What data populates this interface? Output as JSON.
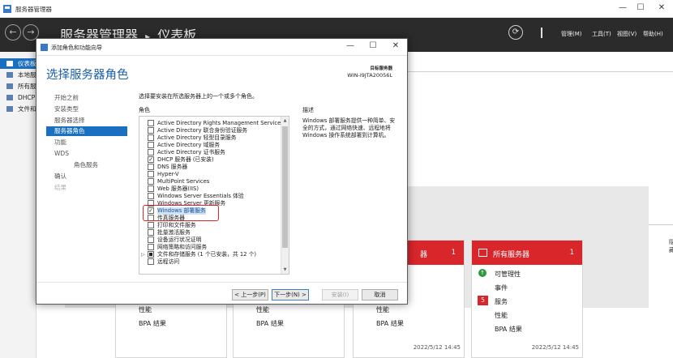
{
  "window": {
    "title": "服务器管理器",
    "controls": {
      "minimize": "—",
      "maximize": "☐",
      "close": "✕"
    }
  },
  "header": {
    "title": "服务器管理器",
    "separator": "▸",
    "page": "仪表板",
    "back": "←",
    "forward": "→",
    "refresh": "⟳",
    "menu": [
      "管理(M)",
      "工具(T)",
      "视图(V)",
      "帮助(H)"
    ]
  },
  "sidebar": {
    "items": [
      {
        "label": "仪表板",
        "active": true
      },
      {
        "label": "本地服务器"
      },
      {
        "label": "所有服务器"
      },
      {
        "label": "DHCP"
      },
      {
        "label": "文件和存储服务"
      }
    ]
  },
  "dashboard": {
    "hide": "隐藏",
    "tiles": [
      {
        "rows": [
          "性能",
          "BPA 结果"
        ]
      },
      {
        "rows": [
          "性能",
          "BPA 结果"
        ]
      },
      {
        "name": "器",
        "count": "1",
        "rows": [
          "性能",
          "BPA 结果"
        ],
        "date": "2022/5/12 14:45"
      },
      {
        "name": "所有服务器",
        "count": "1",
        "manageability": "可管理性",
        "events": "事件",
        "services": "服务",
        "services_badge": "5",
        "perf": "性能",
        "bpa": "BPA 结果",
        "date": "2022/5/12 14:45"
      }
    ]
  },
  "dialog": {
    "title": "添加角色和功能向导",
    "heading": "选择服务器角色",
    "target_label": "目标服务器",
    "target_value": "WIN-I9JTA20056L",
    "instruction": "选择要安装在所选服务器上的一个或多个角色。",
    "roles_header": "角色",
    "desc_header": "描述",
    "description": "Windows 部署服务提供一种简单、安全的方式，通过网络快速、远程地将 Windows 操作系统部署到计算机。",
    "steps": [
      {
        "label": "开始之前"
      },
      {
        "label": "安装类型"
      },
      {
        "label": "服务器选择"
      },
      {
        "label": "服务器角色",
        "active": true
      },
      {
        "label": "功能"
      },
      {
        "label": "WDS"
      },
      {
        "label": "角色服务",
        "sub": true
      },
      {
        "label": "确认"
      },
      {
        "label": "结果",
        "dim": true
      }
    ],
    "roles": [
      {
        "label": "Active Directory Rights Management Services",
        "checked": false
      },
      {
        "label": "Active Directory 联合身份验证服务",
        "checked": false
      },
      {
        "label": "Active Directory 轻型目录服务",
        "checked": false
      },
      {
        "label": "Active Directory 域服务",
        "checked": false
      },
      {
        "label": "Active Directory 证书服务",
        "checked": false
      },
      {
        "label": "DHCP 服务器 (已安装)",
        "checked": true
      },
      {
        "label": "DNS 服务器",
        "checked": false
      },
      {
        "label": "Hyper-V",
        "checked": false
      },
      {
        "label": "MultiPoint Services",
        "checked": false
      },
      {
        "label": "Web 服务器(IIS)",
        "checked": false
      },
      {
        "label": "Windows Server Essentials 体验",
        "checked": false
      },
      {
        "label": "Windows Server 更新服务",
        "checked": false
      },
      {
        "label": "Windows 部署服务",
        "checked": true,
        "highlight": true
      },
      {
        "label": "传真服务器",
        "checked": false
      },
      {
        "label": "打印和文件服务",
        "checked": false
      },
      {
        "label": "批量激活服务",
        "checked": false
      },
      {
        "label": "设备运行状况证明",
        "checked": false
      },
      {
        "label": "网络策略和访问服务",
        "checked": false
      },
      {
        "label": "文件和存储服务 (1 个已安装，共 12 个)",
        "checked": "partial",
        "expander": "▷"
      },
      {
        "label": "远程访问",
        "checked": false
      }
    ],
    "buttons": {
      "prev": "< 上一步(P)",
      "next": "下一步(N) >",
      "install": "安装(I)",
      "cancel": "取消"
    }
  },
  "colors": {
    "accent": "#1a6fc0",
    "alert": "#d9262b",
    "header_bg": "#2b2b2b",
    "heading": "#1a5fa8"
  }
}
